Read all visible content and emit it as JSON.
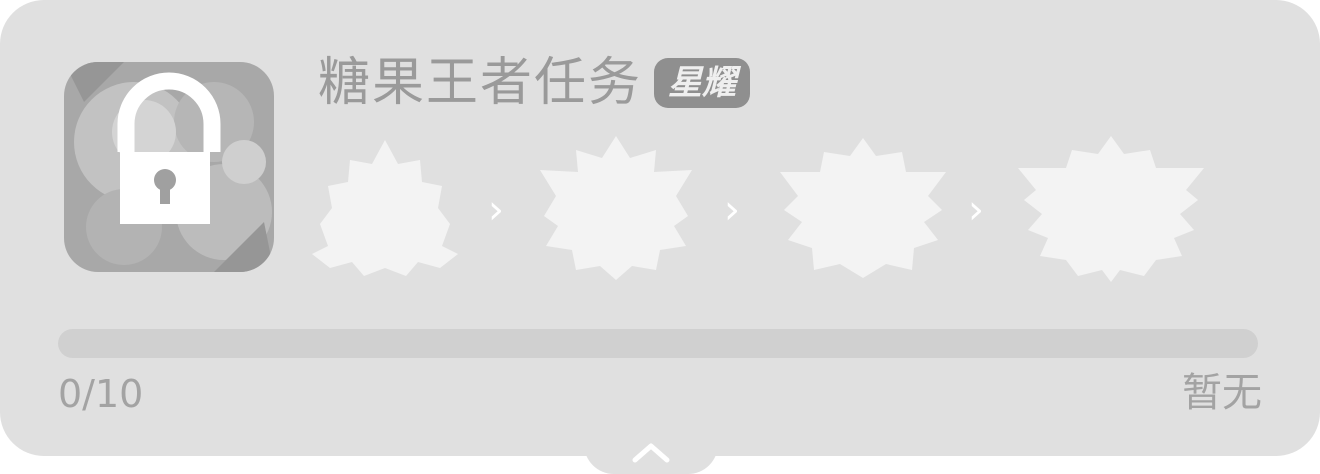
{
  "task": {
    "title": "糖果王者任务",
    "badge": "星耀"
  },
  "ranks": [
    {
      "name": "rank-tier-1"
    },
    {
      "name": "rank-tier-2"
    },
    {
      "name": "rank-tier-3"
    },
    {
      "name": "rank-tier-4"
    }
  ],
  "progress": {
    "text": "0/10",
    "current": 0,
    "total": 10,
    "fraction": 0
  },
  "status": {
    "text": "暂无"
  },
  "icons": {
    "game": "locked-game-icon",
    "arrow": "›",
    "expand": "chevron-up-icon"
  },
  "colors": {
    "card": "#e0e0e0",
    "rank_silhouette": "#f3f3f3",
    "text": "#9a9a9a"
  }
}
